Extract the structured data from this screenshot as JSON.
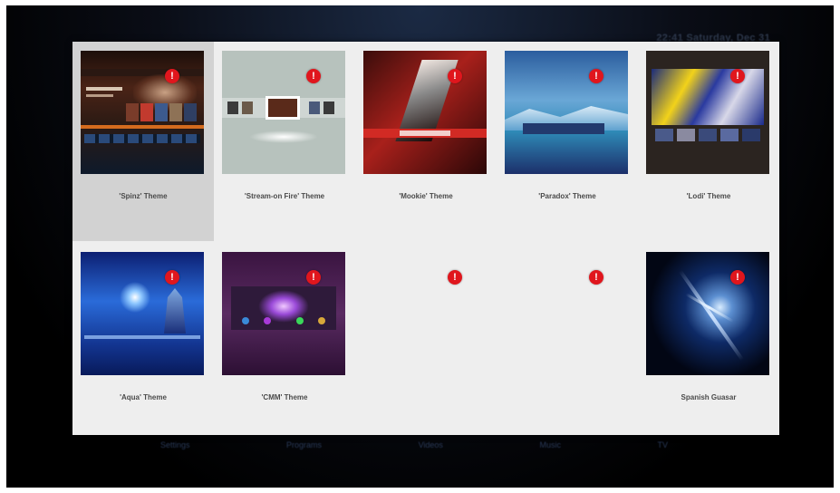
{
  "clock": "22:41 Saturday, Dec 31",
  "bottom_menu": [
    "Settings",
    "Programs",
    "Videos",
    "Music",
    "TV"
  ],
  "badge_glyph": "!",
  "accent_color": "#e0161d",
  "tiles": [
    {
      "label": "'Spinz' Theme",
      "thumb": "spinz-theme-screenshot",
      "selected": true
    },
    {
      "label": "'Stream-on Fire' Theme",
      "thumb": "stream-on-fire-theme-screenshot",
      "selected": false
    },
    {
      "label": "'Mookie' Theme",
      "thumb": "mookie-theme-screenshot",
      "selected": false
    },
    {
      "label": "'Paradox' Theme",
      "thumb": "paradox-theme-screenshot",
      "selected": false
    },
    {
      "label": "'Lodi' Theme",
      "thumb": "lodi-theme-screenshot",
      "selected": false
    },
    {
      "label": "'Aqua' Theme",
      "thumb": "aqua-theme-screenshot",
      "selected": false
    },
    {
      "label": "'CMM' Theme",
      "thumb": "cmm-theme-screenshot",
      "selected": false
    },
    {
      "label": "",
      "thumb": "",
      "selected": false
    },
    {
      "label": "",
      "thumb": "",
      "selected": false
    },
    {
      "label": "Spanish Guasar",
      "thumb": "spanish-guasar-screenshot",
      "selected": false
    }
  ]
}
